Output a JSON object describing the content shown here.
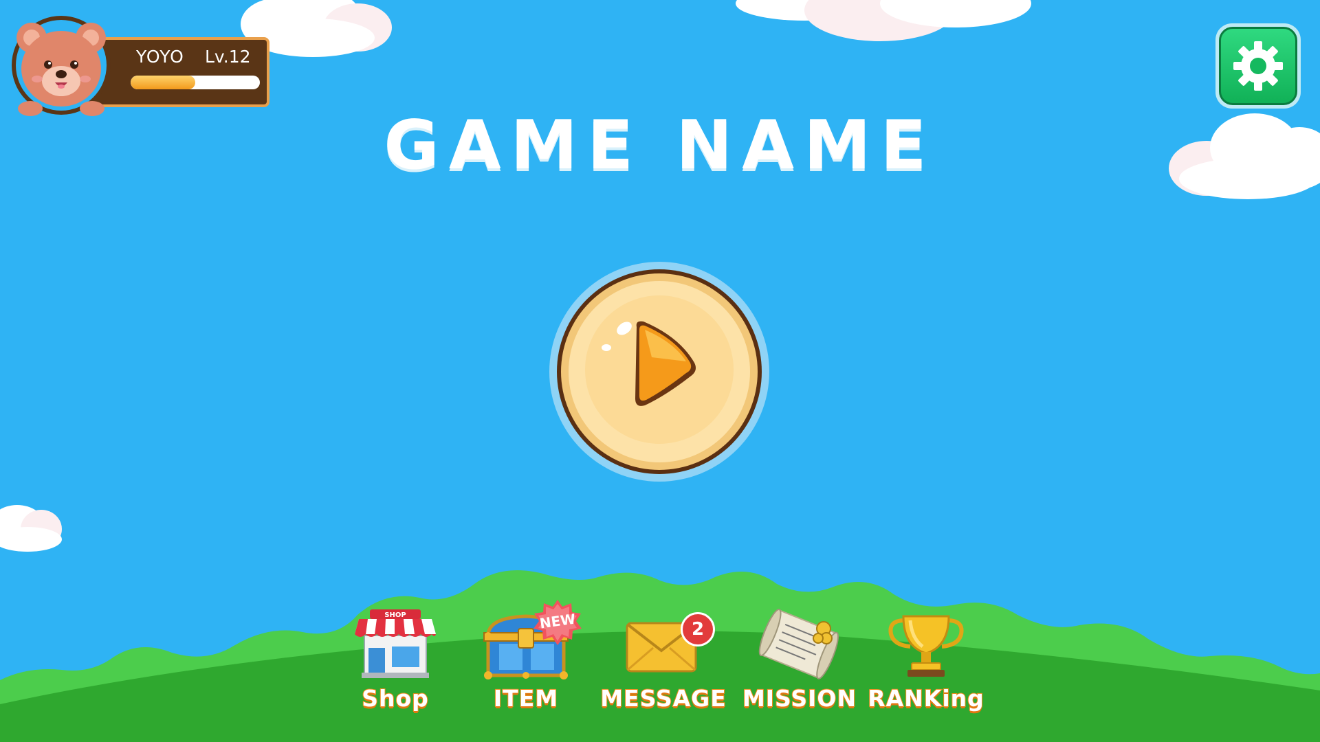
{
  "player": {
    "name": "YOYO",
    "level": "Lv.12",
    "xp_progress": 0.5
  },
  "title": "GAME NAME",
  "menu": {
    "shop": {
      "label": "Shop",
      "sign": "SHOP"
    },
    "item": {
      "label": "ITEM",
      "badge": "NEW"
    },
    "message": {
      "label": "MESSAGE",
      "badge_count": "2"
    },
    "mission": {
      "label": "MISSION"
    },
    "ranking": {
      "label": "RANKing"
    }
  },
  "colors": {
    "sky": "#2fb3f4",
    "grass_back": "#4ccd4c",
    "grass_front": "#2fa82f",
    "settings_green": "#19c166",
    "label_orange": "#f28a1a"
  }
}
